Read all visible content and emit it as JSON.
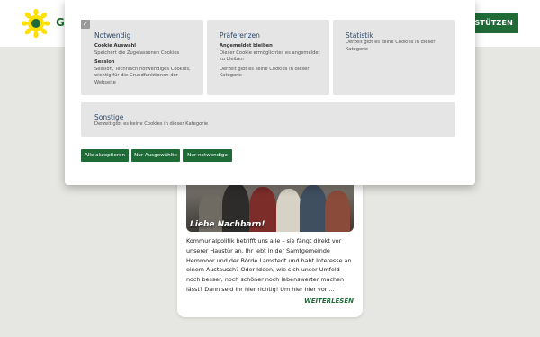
{
  "site": {
    "brand": "GR",
    "support_button": "ERSTÜTZEN",
    "card": {
      "image_caption": "Liebe Nachbarn!",
      "text": "Kommunalpolitik betrifft uns alle – sie fängt direkt vor unserer Haustür an. Ihr lebt in der Samtgemeinde Hemmoor und der Börde Lamstedt und habt Interesse an einem Austausch? Oder Ideen, wie sich unser Umfeld noch besser, noch schöner noch lebenswerter machen lässt? Dann seid Ihr hier richtig! Um hier hier vor …",
      "read_more": "WEITERLESEN"
    }
  },
  "cookie_modal": {
    "categories": [
      {
        "title": "Notwendig",
        "checked": true,
        "entries": [
          {
            "name": "Cookie Auswahl",
            "text": "Speichert die Zugelassenen Cookies"
          },
          {
            "name": "Session",
            "text": "Session, Technisch notwendiges Cookies, wichtig für die Grundfunktionen der Webseite"
          }
        ]
      },
      {
        "title": "Präferenzen",
        "entries": [
          {
            "name": "Angemeldet bleiben",
            "text": "Dieser Cookie ermöglichtes es angemeldet zu bleiben"
          },
          {
            "name": "",
            "text": "Derzeit gibt es keine Cookies in dieser Kategorie"
          }
        ]
      },
      {
        "title": "Statistik",
        "description": "Derzeit gibt es keine Cookies in dieser Kategorie"
      },
      {
        "title": "Sonstige",
        "description": "Derzeit gibt es keine Cookies in dieser Kategorie"
      }
    ],
    "buttons": {
      "accept_all": "Alle akzeptieren",
      "accept_selected": "Nur Ausgewählte",
      "accept_necessary": "Nur notwendige"
    }
  },
  "colors": {
    "brand_green": "#1e6b38",
    "category_bg": "#e5e5e5",
    "category_title": "#2b4a6b",
    "sunflower_yellow": "#ffe000"
  }
}
